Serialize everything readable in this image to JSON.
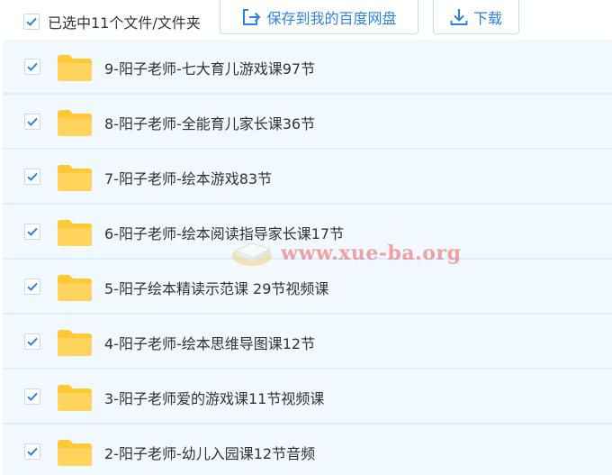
{
  "toolbar": {
    "select_all_label": "已选中11个文件/文件夹",
    "save_button_label": "保存到我的百度网盘",
    "download_button_label": "下载"
  },
  "file_list": {
    "items": [
      {
        "name": "9-阳子老师-七大育儿游戏课97节",
        "checked": true,
        "icon": "folder-icon"
      },
      {
        "name": "8-阳子老师-全能育儿家长课36节",
        "checked": true,
        "icon": "folder-icon"
      },
      {
        "name": "7-阳子老师-绘本游戏83节",
        "checked": true,
        "icon": "folder-icon"
      },
      {
        "name": "6-阳子老师-绘本阅读指导家长课17节",
        "checked": true,
        "icon": "folder-icon"
      },
      {
        "name": "5-阳子绘本精读示范课 29节视频课",
        "checked": true,
        "icon": "folder-icon"
      },
      {
        "name": "4-阳子老师-绘本思维导图课12节",
        "checked": true,
        "icon": "folder-icon"
      },
      {
        "name": "3-阳子老师爱的游戏课11节视频课",
        "checked": true,
        "icon": "folder-icon"
      },
      {
        "name": "2-阳子老师-幼儿入园课12节音频",
        "checked": true,
        "icon": "folder-icon"
      }
    ]
  },
  "watermark": {
    "text": "www.xue-ba.org"
  },
  "colors": {
    "accent": "#2c82e6",
    "row_background": "#f1f8fe",
    "row_divider": "#dceefc",
    "folder": "#ffd35c"
  }
}
